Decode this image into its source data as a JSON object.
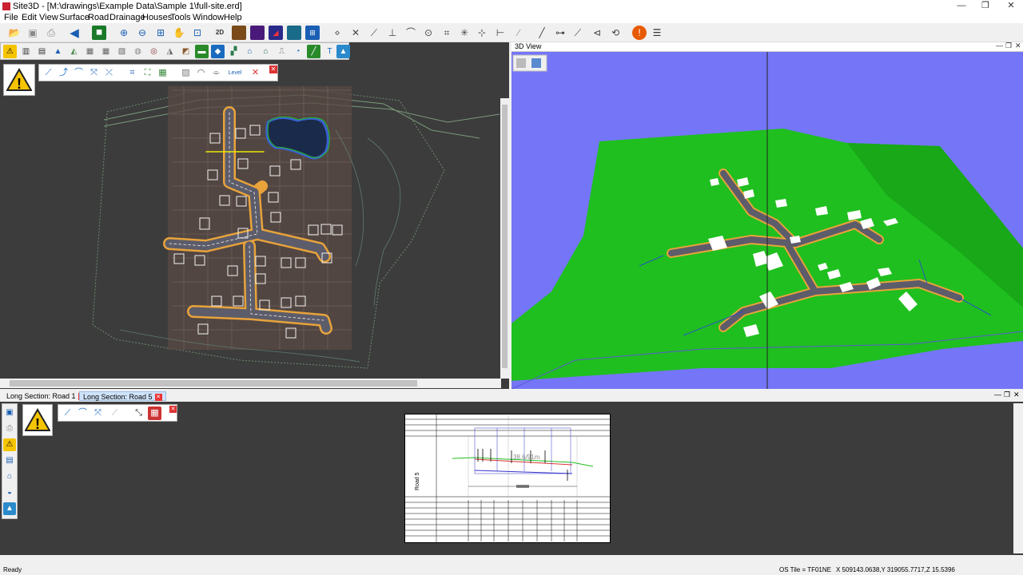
{
  "window": {
    "title": "Site3D - [M:\\drawings\\Example Data\\Sample 1\\full-site.erd]",
    "minimize": "—",
    "restore": "❐",
    "close": "✕"
  },
  "menu": [
    "File",
    "Edit",
    "View",
    "Surface",
    "Road",
    "Drainage",
    "Houses",
    "Tools",
    "Window",
    "Help"
  ],
  "toolbar": {
    "zoom_2d_label": "2D"
  },
  "road_toolbar": {
    "level_label": "Level"
  },
  "view3d": {
    "title": "3D View",
    "win_minimize": "—",
    "win_restore": "❐",
    "win_close": "✕"
  },
  "tabs": [
    {
      "label": "Long Section: Road 1",
      "active": false
    },
    {
      "label": "Long Section: Road 5",
      "active": true
    }
  ],
  "long_section": {
    "road_label": "Road 5",
    "chainage_label": "38.6/91m",
    "win_minimize": "—",
    "win_restore": "❐",
    "win_close": "✕"
  },
  "status": {
    "ready": "Ready",
    "os_tile": "OS Tile = TF01NE",
    "coords": "X 509143.0638,Y 319055.7717,Z 15.5396"
  },
  "colors": {
    "canvas_dark": "#3c3c3c",
    "sky_3d": "#7575f7",
    "terrain_green": "#1fbf1f",
    "road_orange": "#e8a33a",
    "warning_yellow": "#f5c400"
  }
}
